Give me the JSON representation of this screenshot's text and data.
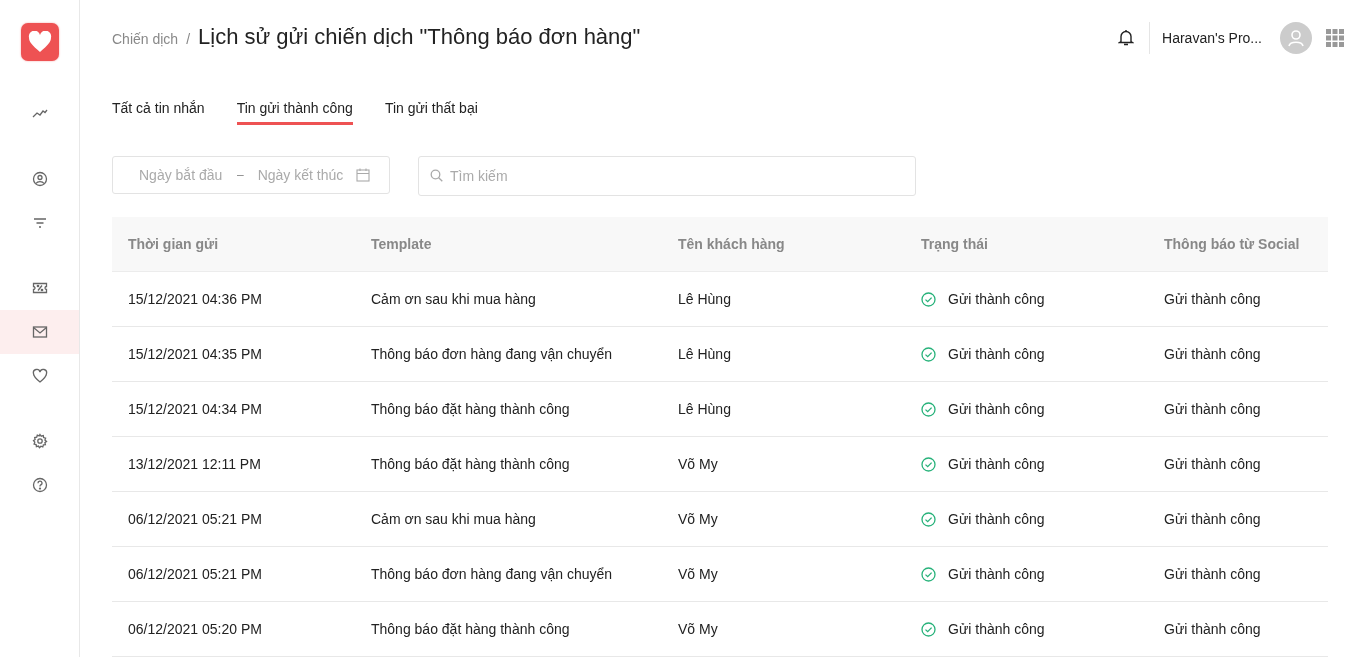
{
  "sidebar": {
    "items": [
      {
        "selected": false
      },
      {
        "selected": false
      },
      {
        "selected": false
      },
      {
        "selected": false
      },
      {
        "selected": true
      },
      {
        "selected": false
      },
      {
        "selected": false
      },
      {
        "selected": false
      }
    ]
  },
  "breadcrumb": {
    "parent": "Chiến dịch",
    "separator": "/",
    "title": "Lịch sử gửi chiến dịch \"Thông báo đơn hàng\""
  },
  "user": {
    "name": "Haravan's Pro..."
  },
  "tabs": [
    {
      "label": "Tất cả tin nhắn",
      "selected": false
    },
    {
      "label": "Tin gửi thành công",
      "selected": true
    },
    {
      "label": "Tin gửi thất bại",
      "selected": false
    }
  ],
  "date_range": {
    "start_placeholder": "Ngày bắt đầu",
    "separator": "–",
    "end_placeholder": "Ngày kết thúc"
  },
  "search": {
    "placeholder": "Tìm kiếm"
  },
  "table": {
    "columns": [
      "Thời gian gửi",
      "Template",
      "Tên khách hàng",
      "Trạng thái",
      "Thông báo từ Social"
    ],
    "rows": [
      {
        "time": "15/12/2021 04:36 PM",
        "template": "Cảm ơn sau khi mua hàng",
        "customer": "Lê Hùng",
        "status": "Gửi thành công",
        "social": "Gửi thành công"
      },
      {
        "time": "15/12/2021 04:35 PM",
        "template": "Thông báo đơn hàng đang vận chuyển",
        "customer": "Lê Hùng",
        "status": "Gửi thành công",
        "social": "Gửi thành công"
      },
      {
        "time": "15/12/2021 04:34 PM",
        "template": "Thông báo đặt hàng thành công",
        "customer": "Lê Hùng",
        "status": "Gửi thành công",
        "social": "Gửi thành công"
      },
      {
        "time": "13/12/2021 12:11 PM",
        "template": "Thông báo đặt hàng thành công",
        "customer": "Võ My",
        "status": "Gửi thành công",
        "social": "Gửi thành công"
      },
      {
        "time": "06/12/2021 05:21 PM",
        "template": "Cảm ơn sau khi mua hàng",
        "customer": "Võ My",
        "status": "Gửi thành công",
        "social": "Gửi thành công"
      },
      {
        "time": "06/12/2021 05:21 PM",
        "template": "Thông báo đơn hàng đang vận chuyển",
        "customer": "Võ My",
        "status": "Gửi thành công",
        "social": "Gửi thành công"
      },
      {
        "time": "06/12/2021 05:20 PM",
        "template": "Thông báo đặt hàng thành công",
        "customer": "Võ My",
        "status": "Gửi thành công",
        "social": "Gửi thành công"
      }
    ]
  }
}
